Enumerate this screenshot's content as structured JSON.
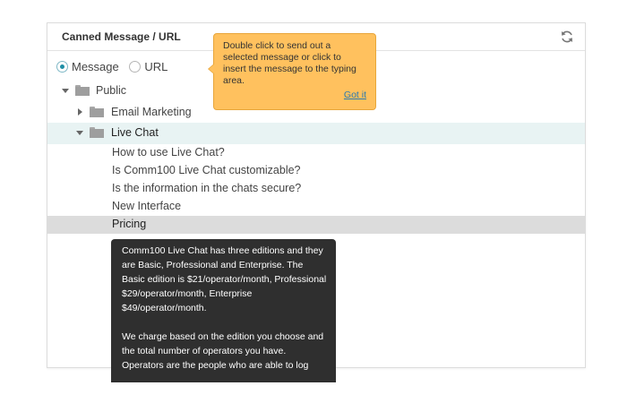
{
  "panel": {
    "title": "Canned Message / URL",
    "refresh_icon": "refresh-icon"
  },
  "type_selector": {
    "options": [
      {
        "label": "Message",
        "checked": true
      },
      {
        "label": "URL",
        "checked": false
      }
    ]
  },
  "tree": {
    "public": {
      "label": "Public",
      "expanded": true
    },
    "email_marketing": {
      "label": "Email Marketing",
      "expanded": false
    },
    "live_chat": {
      "label": "Live Chat",
      "expanded": true,
      "messages": [
        "How to use Live Chat?",
        "Is Comm100 Live Chat customizable?",
        "Is the information in the chats secure?",
        "New Interface",
        "Pricing"
      ],
      "selected_index": 4
    }
  },
  "hint": {
    "text": "Double click to send out a selected message or click to insert the message to the typing area.",
    "action_label": "Got it"
  },
  "preview": {
    "paragraph1": "Comm100 Live Chat has three editions and they are Basic, Professional and Enterprise. The Basic edition is $21/operator/month, Professional $29/operator/month, Enterprise $49/operator/month.",
    "paragraph2": "We charge based on the edition you choose and the total number of operators you have. Operators are the people who are able to log"
  },
  "colors": {
    "accent": "#1f8fa6",
    "live_row_bg": "#e8f3f3",
    "selected_row_bg": "#dcdcdc",
    "hint_bg": "#ffc15e",
    "preview_bg": "#2f2f2f"
  }
}
